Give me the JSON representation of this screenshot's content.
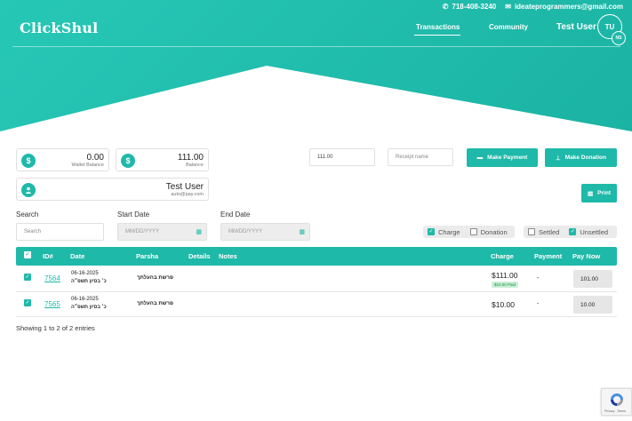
{
  "topbar": {
    "phone": "718-408-3240",
    "email": "ideateprogrammers@gmail.com"
  },
  "brand": {
    "logo": "ClickShul",
    "accent": "#1fb9a9"
  },
  "nav": {
    "items": [
      "Transactions",
      "Community"
    ],
    "active": "Transactions"
  },
  "user": {
    "name": "Test User",
    "initials": "TU",
    "badge": "NS"
  },
  "cards": {
    "wallet": {
      "value": "0.00",
      "label": "Wallet Balance",
      "icon": "dollar-icon"
    },
    "balance": {
      "value": "111.00",
      "label": "Balance",
      "icon": "dollar-icon"
    },
    "profile": {
      "name": "Test User",
      "email": "auto@pay.com",
      "icon": "user-icon"
    }
  },
  "payment": {
    "amount_value": "111.00",
    "receipt_placeholder": "Receipt name",
    "make_payment_label": "Make Payment",
    "make_donation_label": "Make Donation",
    "print_label": "Print"
  },
  "filters": {
    "search_label": "Search",
    "search_placeholder": "Search",
    "start_label": "Start Date",
    "end_label": "End Date",
    "date_placeholder": "MM/DD/YYYY",
    "type": [
      {
        "label": "Charge",
        "checked": true
      },
      {
        "label": "Donation",
        "checked": false
      }
    ],
    "status": [
      {
        "label": "Settled",
        "checked": false
      },
      {
        "label": "Unsettled",
        "checked": true
      }
    ]
  },
  "table": {
    "columns": [
      "ID#",
      "Date",
      "Parsha",
      "Details",
      "Notes",
      "Charge",
      "Payment",
      "Pay Now"
    ],
    "rows": [
      {
        "id": "7564",
        "date": "06-16-2025",
        "hebrew_date": "כ׳ בסיון תשפ״ה",
        "parsha": "פרשת בהעלתך",
        "details": "",
        "notes": "",
        "charge": "$111.00",
        "badge": "$10.00 Paid",
        "payment": "-",
        "pay_now": "101.00"
      },
      {
        "id": "7565",
        "date": "06-16-2025",
        "hebrew_date": "כ׳ בסיון תשפ״ה",
        "parsha": "פרשת בהעלתך",
        "details": "",
        "notes": "",
        "charge": "$10.00",
        "badge": "",
        "payment": "-",
        "pay_now": "10.00"
      }
    ],
    "footer": "Showing 1 to 2 of 2 entries"
  },
  "recaptcha": {
    "text": "Privacy - Terms"
  }
}
